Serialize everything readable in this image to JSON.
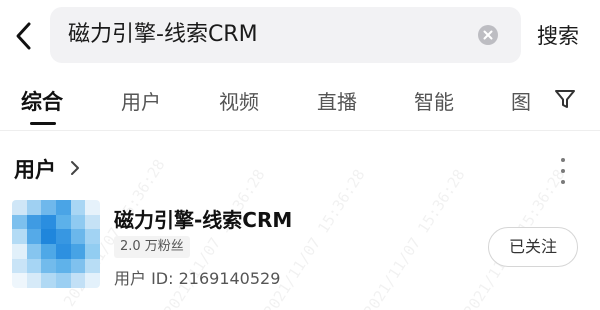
{
  "search": {
    "query": "磁力引擎-线索CRM",
    "submit_label": "搜索"
  },
  "tabs": [
    {
      "label": "综合",
      "active": true
    },
    {
      "label": "用户",
      "active": false
    },
    {
      "label": "视频",
      "active": false
    },
    {
      "label": "直播",
      "active": false
    },
    {
      "label": "智能",
      "active": false
    },
    {
      "label": "图",
      "active": false
    }
  ],
  "section": {
    "title": "用户"
  },
  "user_card": {
    "name": "磁力引擎-线索CRM",
    "fans_badge": "2.0 万粉丝",
    "user_id": "用户 ID: 2169140529",
    "follow_label": "已关注"
  },
  "icons": {
    "back": "chevron-left-icon",
    "clear": "clear-icon",
    "filter": "filter-icon",
    "section_more": "chevron-right-icon",
    "more": "more-vertical-icon"
  },
  "colors": {
    "search_bg": "#f2f2f4",
    "text_primary": "#111111",
    "text_secondary": "#555555",
    "badge_bg": "#f3f3f3"
  }
}
